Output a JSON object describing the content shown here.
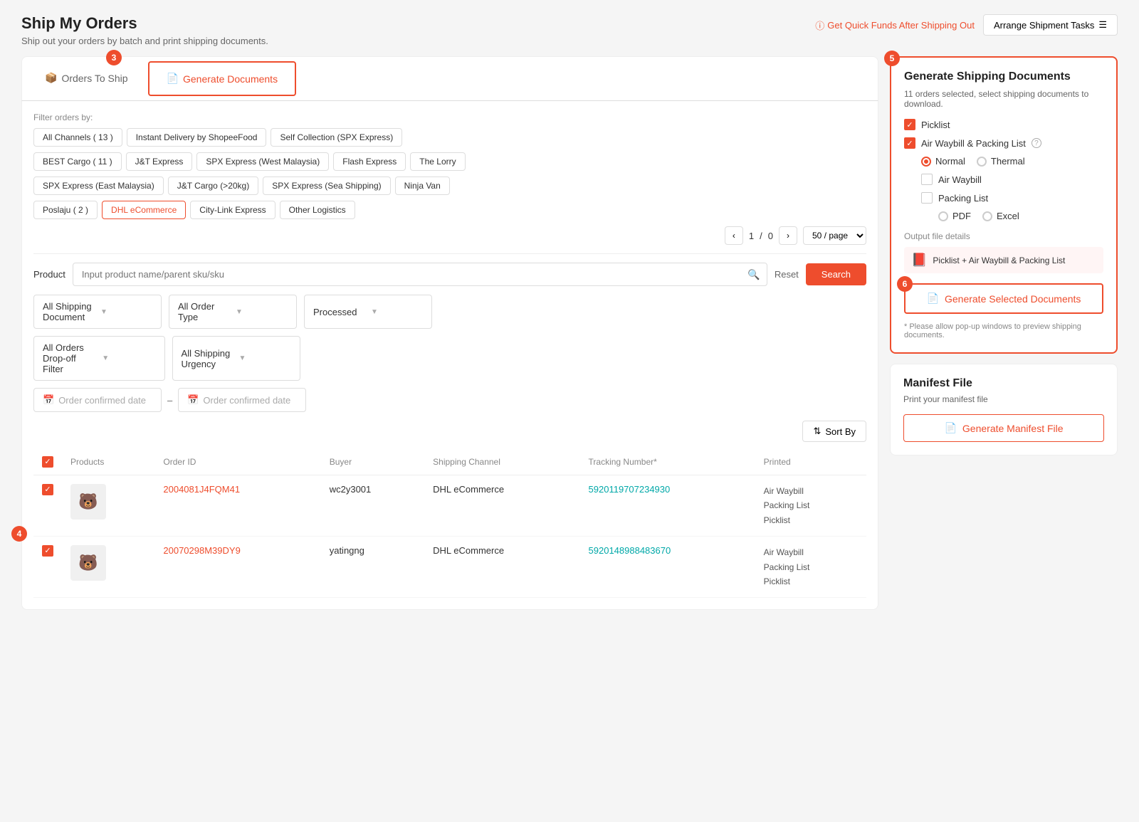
{
  "page": {
    "title": "Ship My Orders",
    "subtitle": "Ship out your orders by batch and print shipping documents.",
    "get_quick_funds": "Get Quick Funds After Shipping Out",
    "arrange_shipment": "Arrange Shipment Tasks"
  },
  "tabs": [
    {
      "id": "orders-to-ship",
      "label": "Orders To Ship",
      "active": false,
      "icon": "📦"
    },
    {
      "id": "generate-documents",
      "label": "Generate Documents",
      "active": true,
      "icon": "📄",
      "highlighted": true
    }
  ],
  "filters": {
    "label": "Filter orders by:",
    "channels": [
      {
        "label": "All Channels ( 13 )",
        "active": false
      },
      {
        "label": "Instant Delivery by ShopeeFood",
        "active": false
      },
      {
        "label": "Self Collection (SPX Express)",
        "active": false
      },
      {
        "label": "BEST Cargo ( 11 )",
        "active": false
      },
      {
        "label": "J&T Express",
        "active": false
      },
      {
        "label": "SPX Express (West Malaysia)",
        "active": false
      },
      {
        "label": "Flash Express",
        "active": false
      },
      {
        "label": "The Lorry",
        "active": false
      },
      {
        "label": "SPX Express (East Malaysia)",
        "active": false
      },
      {
        "label": "J&T Cargo (>20kg)",
        "active": false
      },
      {
        "label": "SPX Express (Sea Shipping)",
        "active": false
      },
      {
        "label": "Ninja Van",
        "active": false
      },
      {
        "label": "Poslaju ( 2 )",
        "active": false
      },
      {
        "label": "DHL eCommerce",
        "active": true
      },
      {
        "label": "City-Link Express",
        "active": false
      },
      {
        "label": "Other Logistics",
        "active": false
      }
    ]
  },
  "pagination": {
    "current": 1,
    "total": 0,
    "per_page": "50 / page"
  },
  "search": {
    "label": "Product",
    "placeholder": "Input product name/parent sku/sku",
    "reset": "Reset",
    "search": "Search"
  },
  "dropdowns": [
    {
      "id": "shipping-doc",
      "label": "All Shipping Document"
    },
    {
      "id": "order-type",
      "label": "All Order Type"
    },
    {
      "id": "status",
      "label": "Processed"
    },
    {
      "id": "dropoff",
      "label": "All Orders Drop-off Filter"
    },
    {
      "id": "urgency",
      "label": "All Shipping Urgency"
    }
  ],
  "dates": {
    "start_placeholder": "Order confirmed date",
    "end_placeholder": "Order confirmed date"
  },
  "sort_btn": "Sort By",
  "table": {
    "headers": [
      "",
      "Products",
      "Order ID",
      "Buyer",
      "Shipping Channel",
      "Tracking Number*",
      "Printed"
    ],
    "rows": [
      {
        "id": "row1",
        "product_emoji": "🐻",
        "order_id": "2004081J4FQM41",
        "buyer": "wc2y3001",
        "shipping_channel": "DHL eCommerce",
        "tracking_number": "5920119707234930",
        "printed": [
          "Air Waybill",
          "Packing List",
          "Picklist"
        ]
      },
      {
        "id": "row2",
        "product_emoji": "🐻",
        "order_id": "20070298M39DY9",
        "buyer": "yatingng",
        "shipping_channel": "DHL eCommerce",
        "tracking_number": "5920148988483670",
        "printed": [
          "Air Waybill",
          "Packing List",
          "Picklist"
        ]
      }
    ]
  },
  "right_panel": {
    "generate_docs": {
      "title": "Generate Shipping Documents",
      "subtitle": "11 orders selected, select shipping documents to download.",
      "options": [
        {
          "id": "picklist",
          "label": "Picklist",
          "checked": true
        },
        {
          "id": "air-waybill-packing",
          "label": "Air Waybill & Packing List",
          "checked": true
        }
      ],
      "radio_options": [
        {
          "id": "normal",
          "label": "Normal",
          "selected": true
        },
        {
          "id": "thermal",
          "label": "Thermal",
          "selected": false
        }
      ],
      "sub_options": [
        {
          "id": "air-waybill-only",
          "label": "Air Waybill",
          "checked": false
        },
        {
          "id": "packing-list",
          "label": "Packing List",
          "checked": false
        }
      ],
      "packing_radio": [
        {
          "id": "pdf",
          "label": "PDF",
          "selected": false
        },
        {
          "id": "excel",
          "label": "Excel",
          "selected": false
        }
      ],
      "output_label": "Output file details",
      "output_file": "Picklist + Air Waybill & Packing List",
      "generate_btn": "Generate Selected Documents",
      "popup_note": "* Please allow pop-up windows to preview shipping documents."
    },
    "manifest": {
      "title": "Manifest File",
      "subtitle": "Print your manifest file",
      "btn_label": "Generate Manifest File"
    }
  },
  "step_badges": {
    "step3": "3",
    "step4": "4",
    "step5": "5",
    "step6": "6"
  },
  "icons": {
    "checkbox_check": "✓",
    "arrow_down": "▼",
    "arrow_left": "‹",
    "arrow_right": "›",
    "search": "🔍",
    "sort": "⇅",
    "calendar": "📅",
    "document": "📄",
    "box": "📦",
    "pdf": "📕"
  }
}
